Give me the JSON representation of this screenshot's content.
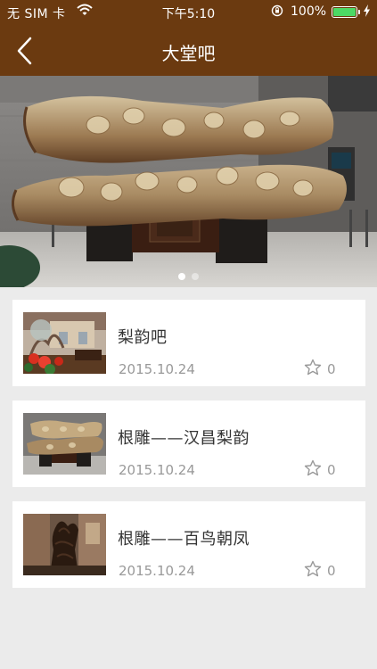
{
  "status_bar": {
    "carrier": "无 SIM 卡",
    "time": "下午5:10",
    "battery_percent": "100%",
    "battery_color": "#4cd964"
  },
  "nav": {
    "title": "大堂吧",
    "back_icon": "chevron-left-icon",
    "bar_color": "#6b3a10"
  },
  "banner": {
    "page_count": 2,
    "active_page": 1
  },
  "items": [
    {
      "title": "梨韵吧",
      "date": "2015.10.24",
      "fav_count": "0",
      "fav_icon": "star-outline-icon"
    },
    {
      "title": "根雕——汉昌梨韵",
      "date": "2015.10.24",
      "fav_count": "0",
      "fav_icon": "star-outline-icon"
    },
    {
      "title": "根雕——百鸟朝凤",
      "date": "2015.10.24",
      "fav_count": "0",
      "fav_icon": "star-outline-icon"
    }
  ]
}
